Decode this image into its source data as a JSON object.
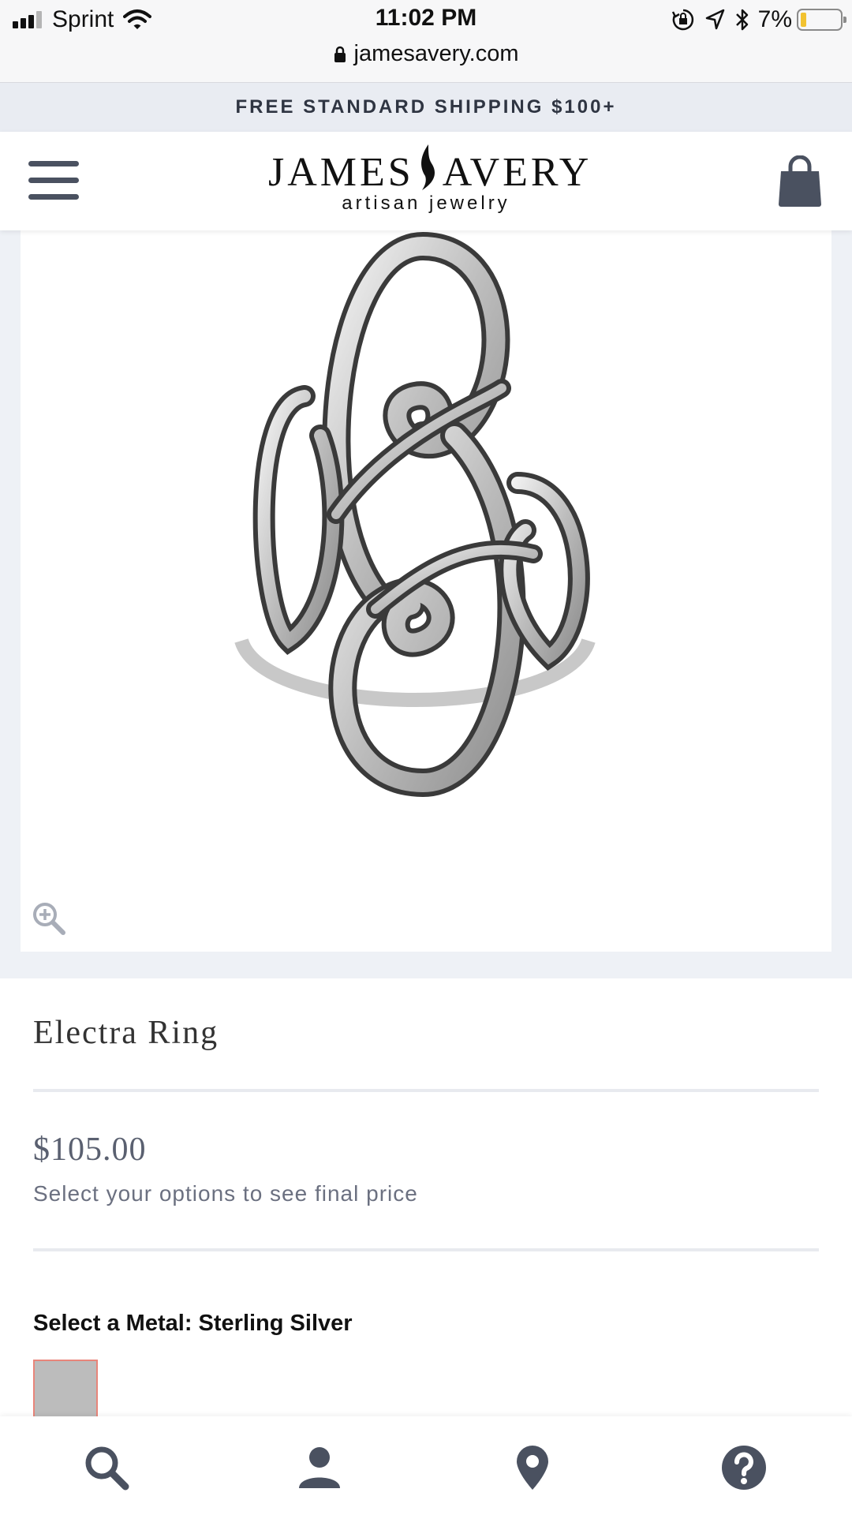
{
  "status_bar": {
    "carrier": "Sprint",
    "time": "11:02 PM",
    "battery_percent": "7%",
    "battery_level": 0.07,
    "url": "jamesavery.com"
  },
  "promo": {
    "text": "FREE STANDARD SHIPPING $100+"
  },
  "header": {
    "logo_name_left": "JAMES",
    "logo_name_right": "AVERY",
    "logo_tagline": "artisan jewelry",
    "menu_icon": "hamburger-icon",
    "cart_icon": "shopping-bag-icon"
  },
  "gallery": {
    "zoom_icon": "zoom-in-icon"
  },
  "product": {
    "title": "Electra Ring",
    "price": "$105.00",
    "price_note": "Select your options to see final price",
    "metal_label": "Select a Metal: Sterling Silver",
    "swatch_color": "#bcbcbc"
  },
  "bottom_nav": {
    "items": [
      {
        "icon": "search-icon"
      },
      {
        "icon": "account-icon"
      },
      {
        "icon": "location-pin-icon"
      },
      {
        "icon": "help-icon"
      }
    ]
  },
  "colors": {
    "promo_bg": "#e9ecf2",
    "icon_gray": "#4a5160",
    "selected_border": "#e8857a"
  }
}
